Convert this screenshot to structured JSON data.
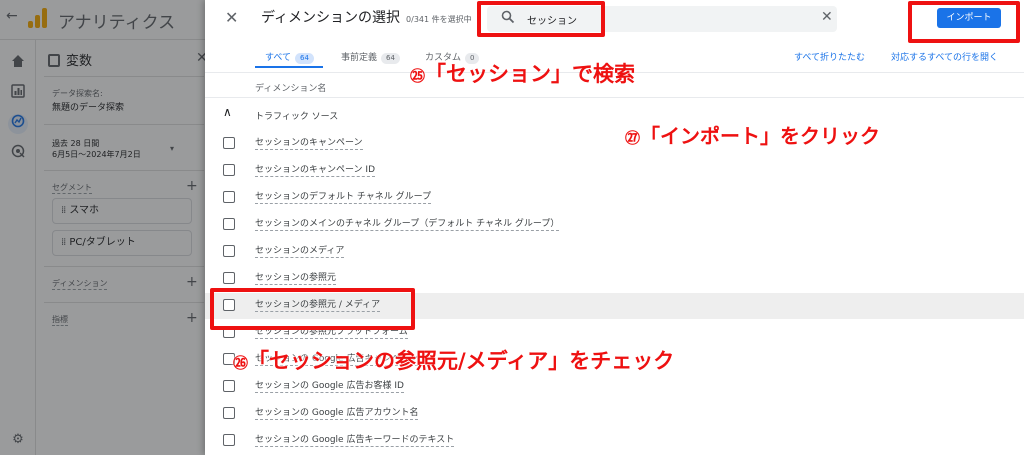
{
  "app": {
    "back_icon": "arrow-back-icon",
    "title": "アナリティクス",
    "logo_color": "#f9ab00"
  },
  "variables_panel": {
    "title": "変数",
    "explore_name_label": "データ探索名:",
    "explore_name": "無題のデータ探索",
    "date_label": "過去 28 日間",
    "date_range": "6月5日～2024年7月2日",
    "segments_label": "セグメント",
    "segments": [
      "スマホ",
      "PC/タブレット"
    ],
    "dimensions_label": "ディメンション",
    "metrics_label": "指標"
  },
  "dialog": {
    "title": "ディメンションの選択",
    "selected_count": "0/341 件を選択中",
    "search_value": "セッション",
    "import_label": "インポート",
    "tabs": [
      {
        "label": "すべて",
        "count": "64"
      },
      {
        "label": "事前定義",
        "count": "64"
      },
      {
        "label": "カスタム",
        "count": "0"
      }
    ],
    "collapse_all": "すべて折りたたむ",
    "expand_matching": "対応するすべての行を開く",
    "column_header": "ディメンション名",
    "group_label": "トラフィック ソース",
    "rows": [
      "セッションのキャンペーン",
      "セッションのキャンペーン ID",
      "セッションのデフォルト チャネル グループ",
      "セッションのメインのチャネル グループ（デフォルト チャネル グループ）",
      "セッションのメディア",
      "セッションの参照元",
      "セッションの参照元 / メディア",
      "セッションの参照元プラットフォーム",
      "セッションの Google 広告キャンペーン",
      "セッションの Google 広告お客様 ID",
      "セッションの Google 広告アカウント名",
      "セッションの Google 広告キーワードのテキスト"
    ],
    "highlight_color": "#eeeeee",
    "accent": "#1a73e8"
  },
  "annotations": {
    "color": "#ee1111",
    "step25": {
      "num": "㉕",
      "text": "「セッション」で検索"
    },
    "step26": {
      "num": "㉖",
      "text": "「セッションの参照元/メディア」をチェック"
    },
    "step27": {
      "num": "㉗",
      "text": "「インポート」をクリック"
    }
  }
}
